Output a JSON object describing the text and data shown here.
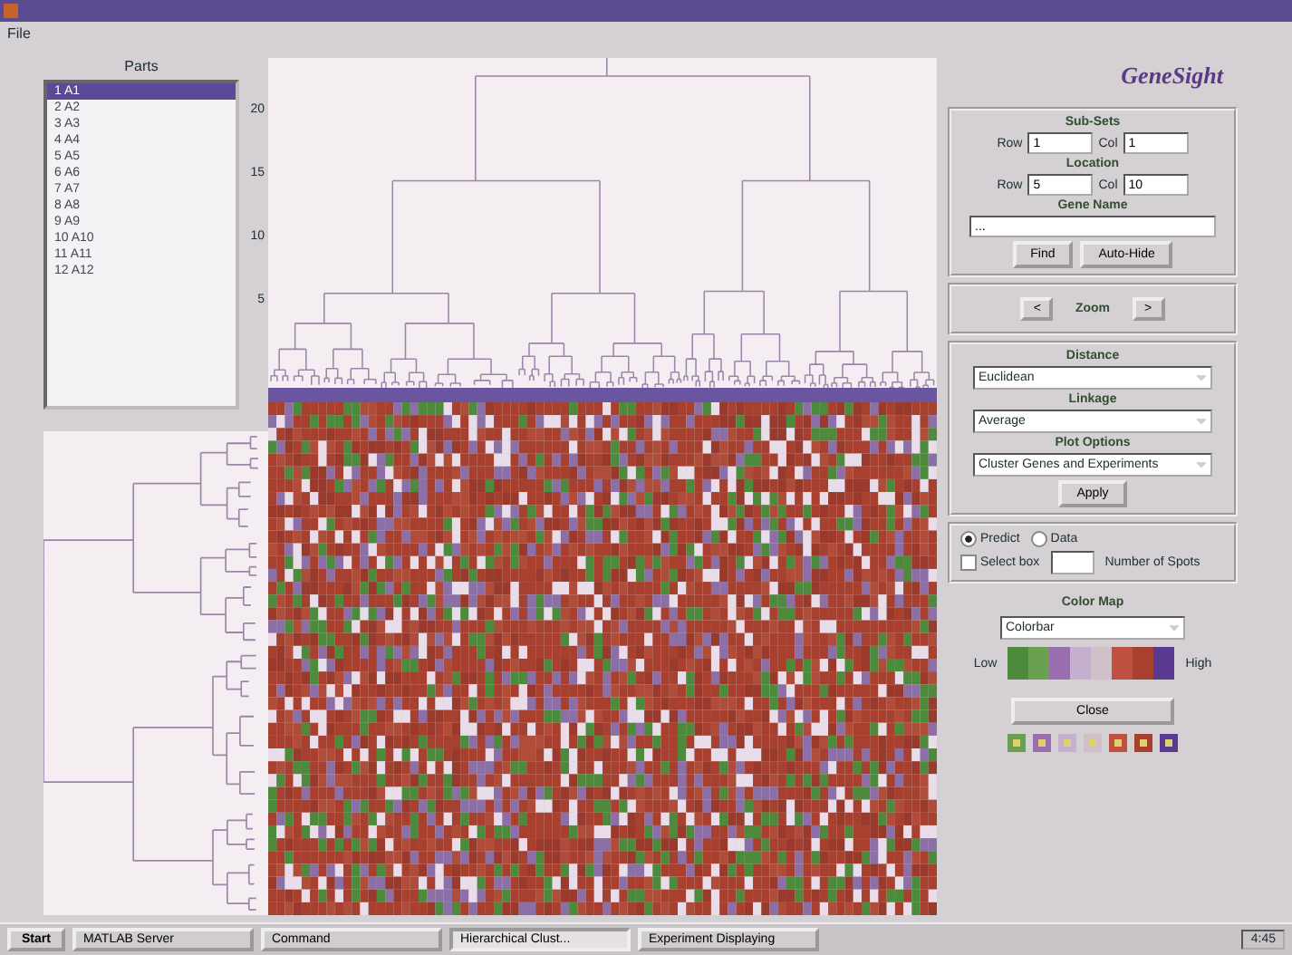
{
  "menu": [
    "File"
  ],
  "parts": {
    "label": "Parts",
    "items": [
      {
        "label": "1  A1",
        "selected": true
      },
      {
        "label": "2  A2",
        "selected": false
      },
      {
        "label": "3  A3",
        "selected": false
      },
      {
        "label": "4  A4",
        "selected": false
      },
      {
        "label": "5  A5",
        "selected": false
      },
      {
        "label": "6  A6",
        "selected": false
      },
      {
        "label": "7  A7",
        "selected": false
      },
      {
        "label": "8  A8",
        "selected": false
      },
      {
        "label": "9  A9",
        "selected": false
      },
      {
        "label": "10 A10",
        "selected": false
      },
      {
        "label": "11 A11",
        "selected": false
      },
      {
        "label": "12 A12",
        "selected": false
      }
    ]
  },
  "dendrogram": {
    "yticks": [
      "20",
      "15",
      "10",
      "5"
    ]
  },
  "brand": "GeneSight",
  "subsets": {
    "title": "Sub-Sets",
    "row_label": "Row",
    "row": "1",
    "col_label": "Col",
    "col": "1"
  },
  "location": {
    "title": "Location",
    "row_label": "Row",
    "row": "5",
    "col_label": "Col",
    "col": "10"
  },
  "gene_name": {
    "title": "Gene Name",
    "value": "...",
    "buttons": [
      "Find",
      "Auto-Hide"
    ]
  },
  "zoom": {
    "prev": "<",
    "label": "Zoom",
    "next": ">"
  },
  "options": [
    {
      "title": "Distance",
      "value": "Euclidean"
    },
    {
      "title": "Linkage",
      "value": "Average"
    },
    {
      "title": "Plot Options",
      "value": "Cluster Genes and Experiments"
    }
  ],
  "apply": "Apply",
  "mode": [
    {
      "label": "Predict",
      "selected": true
    },
    {
      "label": "Data",
      "selected": false
    }
  ],
  "select_box": {
    "label": "Select box",
    "checked": false,
    "spots_label": "Number of Spots"
  },
  "color_map": {
    "title": "Color Map",
    "value": "Colorbar",
    "low": "Low",
    "high": "High"
  },
  "close": "Close",
  "taskbar": {
    "start": "Start",
    "tasks": [
      {
        "label": "MATLAB Server",
        "selected": false
      },
      {
        "label": "Command",
        "selected": false
      },
      {
        "label": "Hierarchical Clust...",
        "selected": true
      },
      {
        "label": "Experiment Displaying",
        "selected": false
      }
    ],
    "clock": "4:45"
  }
}
